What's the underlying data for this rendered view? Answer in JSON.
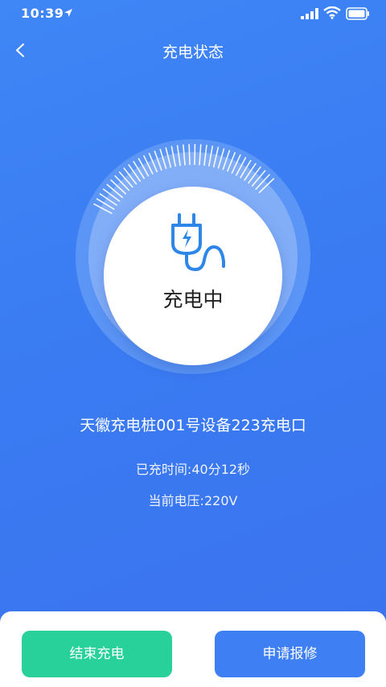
{
  "status_bar": {
    "time": "10:39"
  },
  "nav": {
    "title": "充电状态"
  },
  "charging": {
    "status": "充电中",
    "progress": 0.3
  },
  "device": {
    "name": "天徽充电桩001号设备223充电口"
  },
  "info": {
    "time_label": "已充时间:",
    "time_value": "40分12秒",
    "voltage_label": "当前电压:",
    "voltage_value": "220V"
  },
  "actions": {
    "end_label": "结束充电",
    "repair_label": "申请报修"
  },
  "colors": {
    "accent": "#3f7ff4",
    "end_button": "#28d09a",
    "background": "#3a7bf2"
  }
}
